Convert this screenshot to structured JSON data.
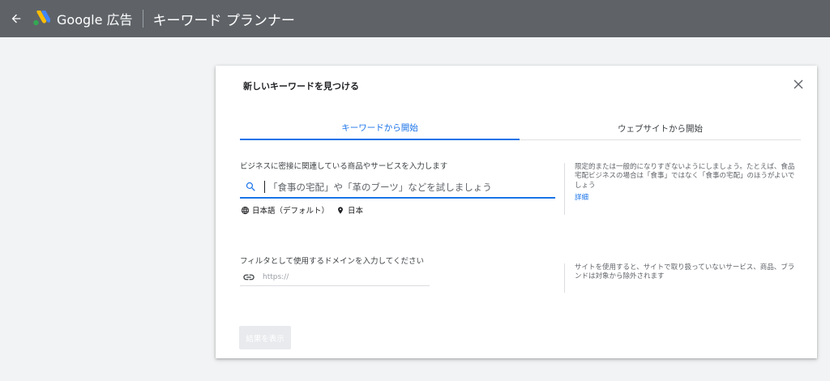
{
  "header": {
    "brand_name": "Google 広告",
    "page_title": "キーワード プランナー",
    "background_color": "#5f6368",
    "icons": [
      "arrow-left-icon",
      "google-ads-logo-icon"
    ]
  },
  "dialog": {
    "title": "新しいキーワードを見つける",
    "close_icon": "close-icon",
    "tabs": [
      {
        "label": "キーワードから開始",
        "active": true
      },
      {
        "label": "ウェブサイトから開始",
        "active": false
      }
    ],
    "accent_color": "#1a73e8",
    "keyword_section": {
      "label": "ビジネスに密接に関連している商品やサービスを入力します",
      "placeholder": "「食事の宅配」や「革のブーツ」などを試しましょう",
      "value": "",
      "language": "日本語（デフォルト）",
      "location": "日本",
      "icons": [
        "search-icon",
        "language-globe-icon",
        "location-pin-icon"
      ],
      "hint": "限定的または一般的になりすぎないようにしましょう。たとえば、食品宅配ビジネスの場合は「食事」ではなく「食事の宅配」のほうがよいでしょう",
      "hint_link": "詳細"
    },
    "domain_section": {
      "label": "フィルタとして使用するドメインを入力してください",
      "placeholder": "https://",
      "value": "",
      "icon": "link-icon",
      "hint": "サイトを使用すると、サイトで取り扱っていないサービス、商品、ブランドは対象から除外されます"
    },
    "submit_label": "結果を表示",
    "submit_enabled": false
  }
}
